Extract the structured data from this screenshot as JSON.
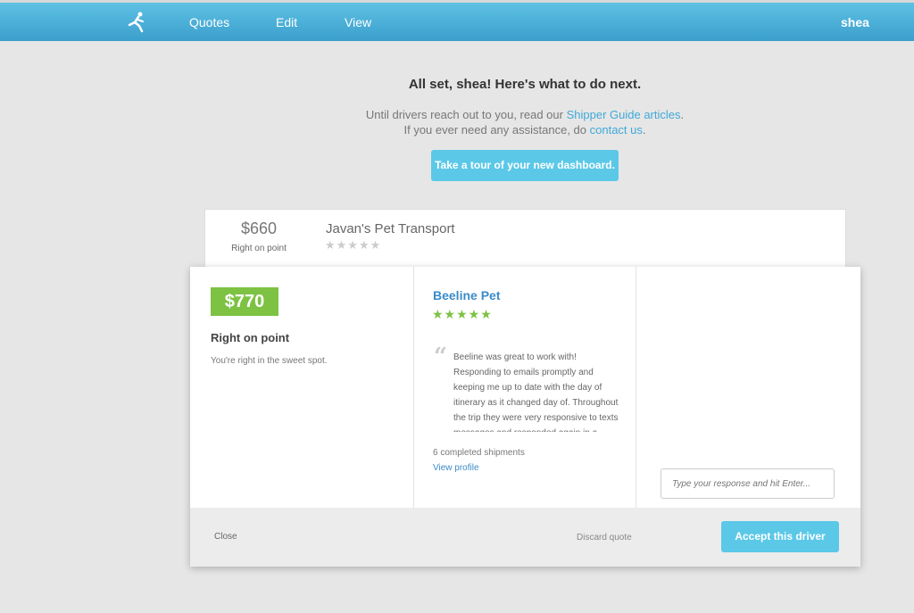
{
  "navbar": {
    "logo_icon": "runner-logo-icon",
    "items": [
      {
        "label": "Quotes"
      },
      {
        "label": "Edit"
      },
      {
        "label": "View"
      }
    ],
    "user": "shea",
    "color": "#3fa9d8"
  },
  "hero": {
    "heading": "All set, shea! Here's what to do next.",
    "line1_prefix": "Until drivers reach out to you, read our ",
    "line1_link": "Shipper Guide articles",
    "line1_suffix": ".",
    "line2_prefix": "If you ever need any assistance, do ",
    "line2_link": "contact us",
    "line2_suffix": ".",
    "tour_button": "Take a tour of your new dashboard."
  },
  "background_quote": {
    "price": "$660",
    "rating_label": "Right on point",
    "driver": "Javan's Pet Transport",
    "stars": "★★★★★",
    "star_count": 0
  },
  "active_quote": {
    "price": "$770",
    "price_color": "#7dc242",
    "rating_label": "Right on point",
    "rating_description": "You're right in the sweet spot.",
    "driver": "Beeline Pet",
    "stars": "★★★★★",
    "star_count": 5,
    "review": "Beeline was great to work with! Responding to emails promptly and keeping me up to date with the day of itinerary as it changed day of. Throughout the trip they were very responsive to texts messages and responded again in a",
    "shipments": "6 completed shipments",
    "profile_link": "View profile",
    "response_placeholder": "Type your response and hit Enter...",
    "close": "Close",
    "discard": "Discard quote",
    "accept": "Accept this driver",
    "accent_color": "#5bc8e8"
  }
}
